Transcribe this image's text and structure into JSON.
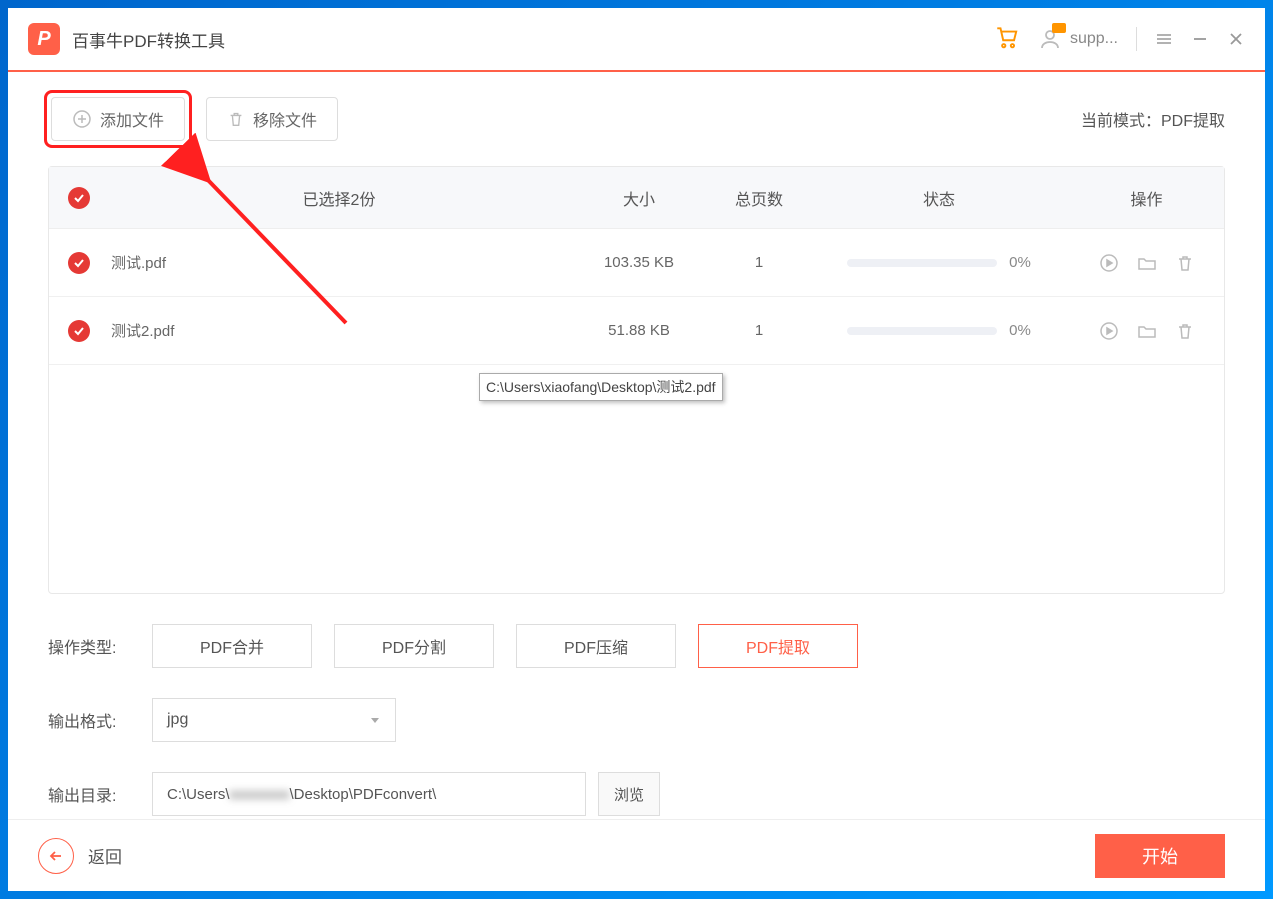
{
  "app": {
    "title": "百事牛PDF转换工具",
    "logo_char": "P"
  },
  "titlebar": {
    "user_name": "supp..."
  },
  "toolbar": {
    "add_file": "添加文件",
    "remove_file": "移除文件",
    "mode_prefix": "当前模式：",
    "mode_value": "PDF提取"
  },
  "table": {
    "headers": {
      "selected": "已选择2份",
      "size": "大小",
      "pages": "总页数",
      "status": "状态",
      "actions": "操作"
    },
    "rows": [
      {
        "name": "测试.pdf",
        "size": "103.35 KB",
        "pages": "1",
        "percent": "0%"
      },
      {
        "name": "测试2.pdf",
        "size": "51.88 KB",
        "pages": "1",
        "percent": "0%"
      }
    ],
    "tooltip": "C:\\Users\\xiaofang\\Desktop\\测试2.pdf"
  },
  "options": {
    "op_type_label": "操作类型:",
    "op_buttons": [
      "PDF合并",
      "PDF分割",
      "PDF压缩",
      "PDF提取"
    ],
    "op_active_index": 3,
    "format_label": "输出格式:",
    "format_value": "jpg",
    "dir_label": "输出目录:",
    "dir_prefix": "C:\\Users\\",
    "dir_blur": "xxxxxxxx",
    "dir_suffix": "\\Desktop\\PDFconvert\\",
    "browse": "浏览"
  },
  "footer": {
    "back": "返回",
    "start": "开始"
  }
}
